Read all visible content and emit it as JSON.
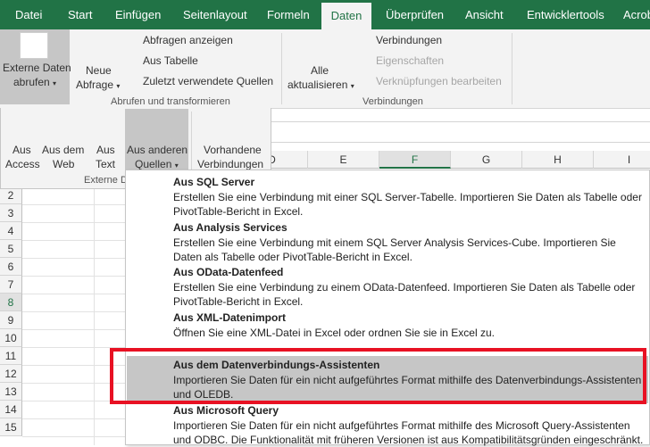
{
  "tabs": [
    "Datei",
    "Start",
    "Einfügen",
    "Seitenlayout",
    "Formeln",
    "Daten",
    "Überprüfen",
    "Ansicht",
    "Entwicklertools",
    "Acrob"
  ],
  "active_tab": "Daten",
  "ribbon": {
    "externe_daten": {
      "line1": "Externe Daten",
      "line2": "abrufen"
    },
    "neue_abfrage": {
      "line1": "Neue",
      "line2": "Abfrage"
    },
    "abfragen_items": [
      "Abfragen anzeigen",
      "Aus Tabelle",
      "Zuletzt verwendete Quellen"
    ],
    "group_abrufen": "Abrufen und transformieren",
    "alle_aktualisieren": {
      "line1": "Alle",
      "line2": "aktualisieren"
    },
    "verbindungen_items": [
      "Verbindungen",
      "Eigenschaften",
      "Verknüpfungen bearbeiten"
    ],
    "group_verbindungen": "Verbindungen"
  },
  "externe_panel": {
    "buttons": [
      {
        "line1": "Aus",
        "line2": "Access"
      },
      {
        "line1": "Aus dem",
        "line2": "Web"
      },
      {
        "line1": "Aus",
        "line2": "Text"
      },
      {
        "line1": "Aus anderen",
        "line2": "Quellen"
      },
      {
        "line1": "Vorhandene",
        "line2": "Verbindungen"
      }
    ],
    "group_label": "Externe D"
  },
  "columns": [
    "D",
    "E",
    "F",
    "G",
    "H",
    "I"
  ],
  "selected_column": "F",
  "rows": [
    "2",
    "3",
    "4",
    "5",
    "6",
    "7",
    "8",
    "9",
    "10",
    "11",
    "12",
    "13",
    "14",
    "15"
  ],
  "selected_row": "8",
  "dropdown_items": [
    {
      "title": "Aus SQL Server",
      "desc": "Erstellen Sie eine Verbindung mit einer SQL Server-Tabelle. Importieren Sie Daten als Tabelle oder PivotTable-Bericht in Excel."
    },
    {
      "title": "Aus Analysis Services",
      "desc": "Erstellen Sie eine Verbindung mit einem SQL Server Analysis Services-Cube. Importieren Sie Daten als Tabelle oder PivotTable-Bericht in Excel."
    },
    {
      "title": "Aus OData-Datenfeed",
      "desc": "Erstellen Sie eine Verbindung zu einem OData-Datenfeed. Importieren Sie Daten als Tabelle oder PivotTable-Bericht in Excel."
    },
    {
      "title": "Aus XML-Datenimport",
      "desc": "Öffnen Sie eine XML-Datei in Excel oder ordnen Sie sie in Excel zu."
    },
    {
      "title": "Aus dem Datenverbindungs-Assistenten",
      "desc": "Importieren Sie Daten für ein nicht aufgeführtes Format mithilfe des Datenverbindungs-Assistenten und OLEDB."
    },
    {
      "title": "Aus Microsoft Query",
      "desc": "Importieren Sie Daten für ein nicht aufgeführtes Format mithilfe des Microsoft Query-Assistenten und ODBC. Die Funktionalität mit früheren Versionen ist aus Kompatibilitätsgründen eingeschränkt."
    }
  ],
  "highlighted_item": "Aus dem Datenverbindungs-Assistenten",
  "colors": {
    "excel_green": "#217346",
    "highlight": "#c6c6c6",
    "callout_red": "#e81123"
  }
}
